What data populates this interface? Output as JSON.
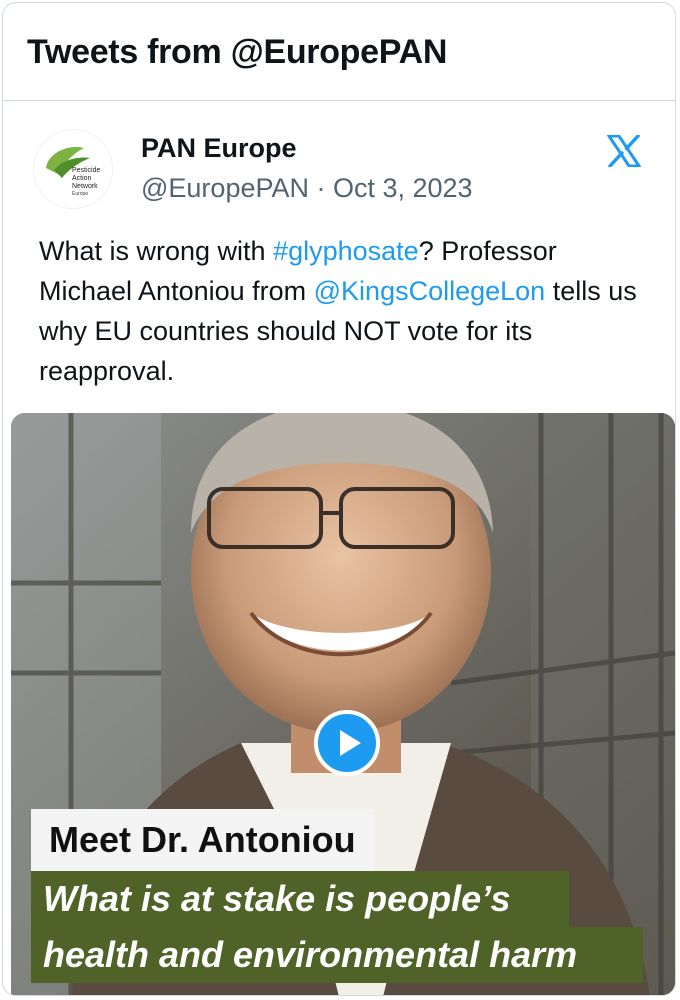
{
  "widget": {
    "title": "Tweets from @EuropePAN"
  },
  "tweet": {
    "display_name": "PAN Europe",
    "handle_date": "@EuropePAN · Oct 3, 2023",
    "text": {
      "part1": "What is wrong with ",
      "hashtag": "#glyphosate",
      "part2": "? Professor Michael Antoniou from ",
      "mention": "@KingsCollegeLon",
      "part3": " tells us why EU countries should NOT vote for its reapproval."
    },
    "avatar_logo": {
      "line1": "Pesticide",
      "line2": "Action",
      "line3": "Network",
      "line4": "Europe"
    },
    "link_color": "#1d9bf0",
    "media": {
      "caption_1": "Meet Dr. Antoniou",
      "caption_2": "What is at stake is people’s",
      "caption_3": "health and environmental harm",
      "caption_band_color": "#4f6328"
    }
  },
  "icons": {
    "platform": "x-logo-icon",
    "play": "play-icon",
    "avatar": "pesticide-leaf-logo-icon"
  }
}
